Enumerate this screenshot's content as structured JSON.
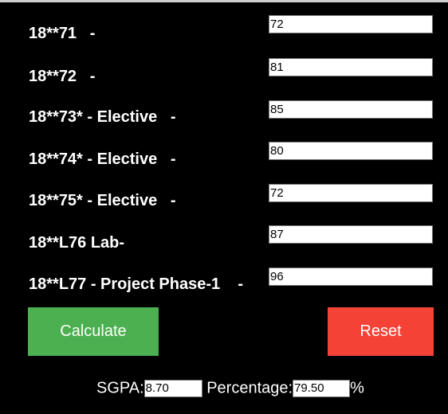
{
  "subjects": [
    {
      "label": "18**71   -",
      "marks": "72"
    },
    {
      "label": "18**72   -",
      "marks": "81"
    },
    {
      "label": "18**73* - Elective   -",
      "marks": "85"
    },
    {
      "label": "18**74* - Elective   -",
      "marks": "80"
    },
    {
      "label": "18**75* - Elective   -",
      "marks": "72"
    },
    {
      "label": "18**L76 Lab-",
      "marks": "87"
    },
    {
      "label": "18**L77 - Project Phase-1    -",
      "marks": "96"
    }
  ],
  "buttons": {
    "calculate": "Calculate",
    "reset": "Reset"
  },
  "results": {
    "sgpa_label": "SGPA:",
    "sgpa_value": "8.70",
    "percentage_label": "Percentage:",
    "percentage_value": "79.50",
    "percent_sign": "%"
  },
  "colors": {
    "background": "#000000",
    "calculate": "#4caf50",
    "reset": "#f44336"
  }
}
